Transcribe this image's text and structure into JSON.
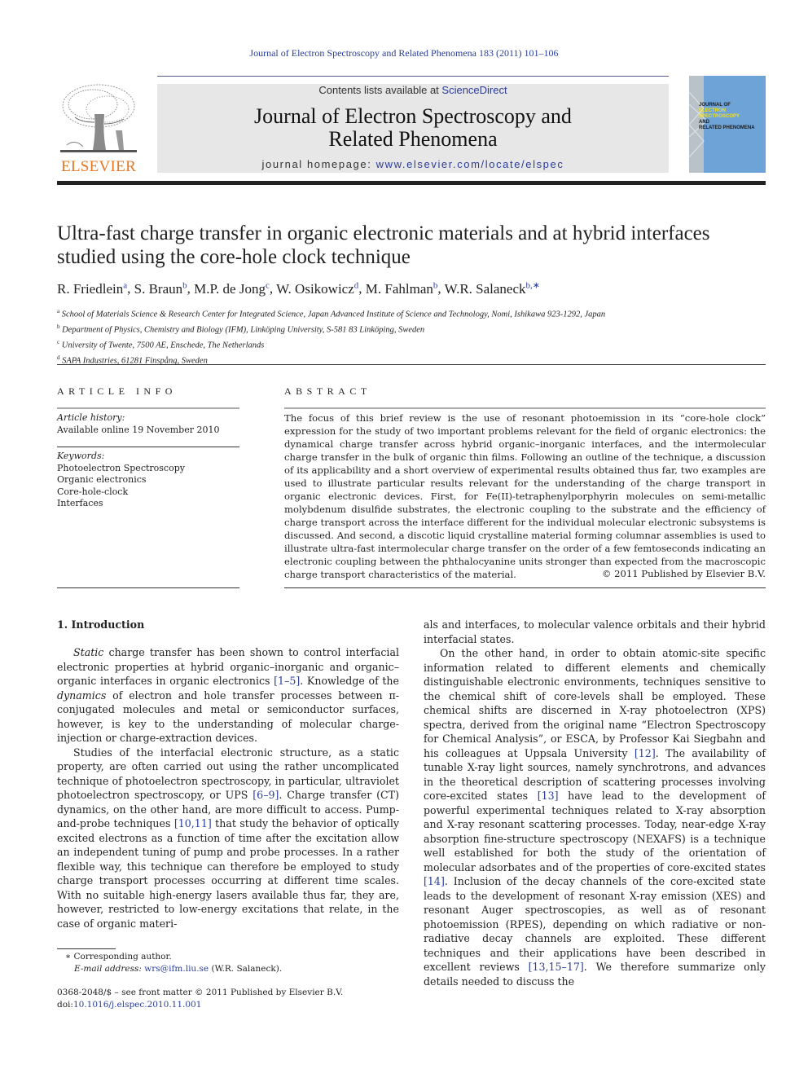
{
  "running_head": "Journal of Electron Spectroscopy and Related Phenomena 183 (2011) 101–106",
  "masthead": {
    "publisher_logo_text": "ELSEVIER",
    "contents_prefix": "Contents lists available at ",
    "contents_link": "ScienceDirect",
    "journal_title_line1": "Journal of Electron Spectroscopy and",
    "journal_title_line2": "Related Phenomena",
    "homepage_prefix": "journal homepage: ",
    "homepage_link": "www.elsevier.com/locate/elspec",
    "cover": {
      "line1": "JOURNAL OF",
      "line2": "ELECTRON",
      "line3": "SPECTROSCOPY",
      "line4": "AND",
      "line5": "RELATED PHENOMENA"
    },
    "colors": {
      "elsevier_orange": "#e87722",
      "link_blue": "#2a3d9a",
      "cover_blue": "#6ea3d8",
      "masthead_grey": "#e7e7e7"
    }
  },
  "article": {
    "title_line1": "Ultra-fast charge transfer in organic electronic materials and at hybrid interfaces",
    "title_line2": "studied using the core-hole clock technique",
    "authors": [
      {
        "name": "R. Friedlein",
        "sup": "a"
      },
      {
        "name": "S. Braun",
        "sup": "b"
      },
      {
        "name": "M.P. de Jong",
        "sup": "c"
      },
      {
        "name": "W. Osikowicz",
        "sup": "d"
      },
      {
        "name": "M. Fahlman",
        "sup": "b"
      },
      {
        "name": "W.R. Salaneck",
        "sup": "b,∗"
      }
    ],
    "affiliations": [
      {
        "sup": "a",
        "text": "School of Materials Science & Research Center for Integrated Science, Japan Advanced Institute of Science and Technology, Nomi, Ishikawa 923-1292, Japan"
      },
      {
        "sup": "b",
        "text": "Department of Physics, Chemistry and Biology (IFM), Linköping University, S-581 83 Linköping, Sweden"
      },
      {
        "sup": "c",
        "text": "University of Twente, 7500 AE, Enschede, The Netherlands"
      },
      {
        "sup": "d",
        "text": "SAPA Industries, 61281 Finspång, Sweden"
      }
    ]
  },
  "article_info": {
    "heading": "ARTICLE INFO",
    "history_label": "Article history:",
    "history_value": "Available online 19 November 2010",
    "keywords_label": "Keywords:",
    "keywords": [
      "Photoelectron Spectroscopy",
      "Organic electronics",
      "Core-hole-clock",
      "Interfaces"
    ]
  },
  "abstract": {
    "heading": "ABSTRACT",
    "text": "The focus of this brief review is the use of resonant photoemission in its “core-hole clock” expression for the study of two important problems relevant for the field of organic electronics: the dynamical charge transfer across hybrid organic–inorganic interfaces, and the intermolecular charge transfer in the bulk of organic thin films. Following an outline of the technique, a discussion of its applicability and a short overview of experimental results obtained thus far, two examples are used to illustrate particular results relevant for the understanding of the charge transport in organic electronic devices. First, for Fe(II)-tetraphenylporphyrin molecules on semi-metallic molybdenum disulfide substrates, the electronic coupling to the substrate and the efficiency of charge transport across the interface different for the individual molecular electronic subsystems is discussed. And second, a discotic liquid crystalline material forming columnar assemblies is used to illustrate ultra-fast intermolecular charge transfer on the order of a few femtoseconds indicating an electronic coupling between the phthalocyanine units stronger than expected from the macroscopic charge transport characteristics of the material.",
    "copyright": "© 2011 Published by Elsevier B.V."
  },
  "body": {
    "section_heading": "1.  Introduction",
    "left": {
      "p1_em1": "Static",
      "p1_a": " charge transfer has been shown to control interfacial electronic properties at hybrid organic–inorganic and organic–organic interfaces in organic electronics ",
      "p1_ref1": "[1–5]",
      "p1_b": ". Knowledge of the ",
      "p1_em2": "dynamics",
      "p1_c": " of electron and hole transfer processes between π-conjugated molecules and metal or semiconductor surfaces, however, is key to the understanding of molecular charge-injection or charge-extraction devices.",
      "p2_a": "Studies of the interfacial electronic structure, as a static property, are often carried out using the rather uncomplicated technique of photoelectron spectroscopy, in particular, ultraviolet photoelectron spectroscopy, or UPS ",
      "p2_ref1": "[6–9]",
      "p2_b": ". Charge transfer (CT) dynamics, on the other hand, are more difficult to access. Pump-and-probe techniques ",
      "p2_ref2": "[10,11]",
      "p2_c": " that study the behavior of optically excited electrons as a function of time after the excitation allow an independent tuning of pump and probe processes. In a rather flexible way, this technique can therefore be employed to study charge transport processes occurring at different time scales. With no suitable high-energy lasers available thus far, they are, however, restricted to low-energy excitations that relate, in the case of organic materi-"
    },
    "right": {
      "p0": "als and interfaces, to molecular valence orbitals and their hybrid interfacial states.",
      "p1_a": "On the other hand, in order to obtain atomic-site specific information related to different elements and chemically distinguishable electronic environments, techniques sensitive to the chemical shift of core-levels shall be employed. These chemical shifts are discerned in X-ray photoelectron (XPS) spectra, derived from the original name “Electron Spectroscopy for Chemical Analysis”, or ESCA, by Professor Kai Siegbahn and his colleagues at Uppsala University ",
      "p1_ref1": "[12]",
      "p1_b": ". The availability of tunable X-ray light sources, namely synchrotrons, and advances in the theoretical description of scattering processes involving core-excited states ",
      "p1_ref2": "[13]",
      "p1_c": " have lead to the development of powerful experimental techniques related to X-ray absorption and X-ray resonant scattering processes. Today, near-edge X-ray absorption fine-structure spectroscopy (NEXAFS) is a technique well established for both the study of the orientation of molecular adsorbates and of the properties of core-excited states ",
      "p1_ref3": "[14]",
      "p1_d": ". Inclusion of the decay channels of the core-excited state leads to the development of resonant X-ray emission (XES) and resonant Auger spectroscopies, as well as of resonant photoemission (RPES), depending on which radiative or non-radiative decay channels are exploited. These different techniques and their applications have been described in excellent reviews ",
      "p1_ref4": "[13,15–17]",
      "p1_e": ". We therefore summarize only details needed to discuss the"
    }
  },
  "footnotes": {
    "corresponding": "∗ Corresponding author.",
    "email_label": "E-mail address: ",
    "email": "wrs@ifm.liu.se",
    "email_suffix": " (W.R. Salaneck)."
  },
  "front_matter": {
    "issn_line": "0368-2048/$ – see front matter © 2011 Published by Elsevier B.V.",
    "doi_prefix": "doi:",
    "doi": "10.1016/j.elspec.2010.11.001"
  }
}
